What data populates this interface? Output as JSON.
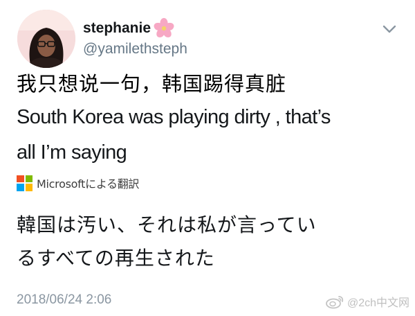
{
  "tweet": {
    "display_name": "stephanie",
    "name_emoji_icon": "cherry-blossom-icon",
    "handle": "@yamilethsteph",
    "menu_icon": "chevron-down-icon",
    "text_chinese": "我只想说一句，韩国踢得真脏",
    "text_english_line1": "South Korea was playing dirty , that’s",
    "text_english_line2": "all I’m saying",
    "translation_label": "Microsoftによる翻訳",
    "translation_icon": "microsoft-logo-icon",
    "translated_line1": "韓国は汚い、それは私が言ってい",
    "translated_line2": "るすべての再生された",
    "timestamp": "2018/06/24 2:06"
  },
  "watermark": {
    "icon": "weibo-icon",
    "text": "@2ch中文网"
  },
  "colors": {
    "handle_gray": "#657786",
    "timestamp_gray": "#8a96a1",
    "ms_red": "#f25022",
    "ms_green": "#7fba00",
    "ms_blue": "#00a4ef",
    "ms_yellow": "#ffb900",
    "avatar_bg": "#f3d6d8"
  }
}
